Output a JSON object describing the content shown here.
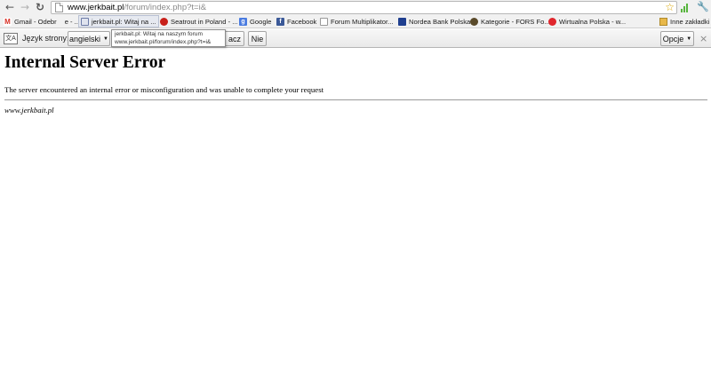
{
  "toolbar": {
    "back_icon": "back-arrow-icon",
    "forward_icon": "forward-arrow-icon",
    "reload_icon": "reload-icon",
    "url_host": "www.jerkbait.pl",
    "url_path": "/forum/index.php?t=i&",
    "star_icon": "bookmark-star-icon",
    "wrench_icon": "wrench-icon"
  },
  "bookmarks": [
    {
      "label": "Gmail - Odebr",
      "suffix": "e - ...",
      "icon": "gmail-icon",
      "color": "#d93025"
    },
    {
      "label": "jerkbait.pl: Witaj na ...",
      "icon": "site-icon",
      "color": "#6b7aa6"
    },
    {
      "label": "Seatrout in Poland - ...",
      "icon": "seatrout-icon",
      "color": "#c8201a"
    },
    {
      "label": "Google",
      "icon": "google-icon",
      "color": "#4a7be0"
    },
    {
      "label": "Facebook",
      "icon": "facebook-icon",
      "color": "#3b5998"
    },
    {
      "label": "Forum Multiplikator...",
      "icon": "page-icon",
      "color": "#ffffff"
    },
    {
      "label": "Nordea Bank Polska",
      "icon": "nordea-icon",
      "color": "#1f3f8f"
    },
    {
      "label": "Kategorie - FORS Fo...",
      "icon": "fors-icon",
      "color": "#5a4a2a"
    },
    {
      "label": "Wirtualna Polska - w...",
      "icon": "wp-icon",
      "color": "#e0262d"
    },
    {
      "label": "Inne zakładki",
      "icon": "folder-icon",
      "color": "#e8b84a"
    }
  ],
  "tooltip": {
    "line1": "jerkbait.pl: Witaj na naszym forum",
    "line2": "www.jerkbait.pl/forum/index.php?t=i&"
  },
  "infobar": {
    "label": "Język strony:",
    "language": "angielski",
    "translate_label": "acz",
    "no_label": "Nie",
    "options_label": "Opcje",
    "close_glyph": "×"
  },
  "page": {
    "title": "Internal Server Error",
    "message": "The server encountered an internal error or misconfiguration and was unable to complete your request",
    "address": "www.jerkbait.pl"
  }
}
